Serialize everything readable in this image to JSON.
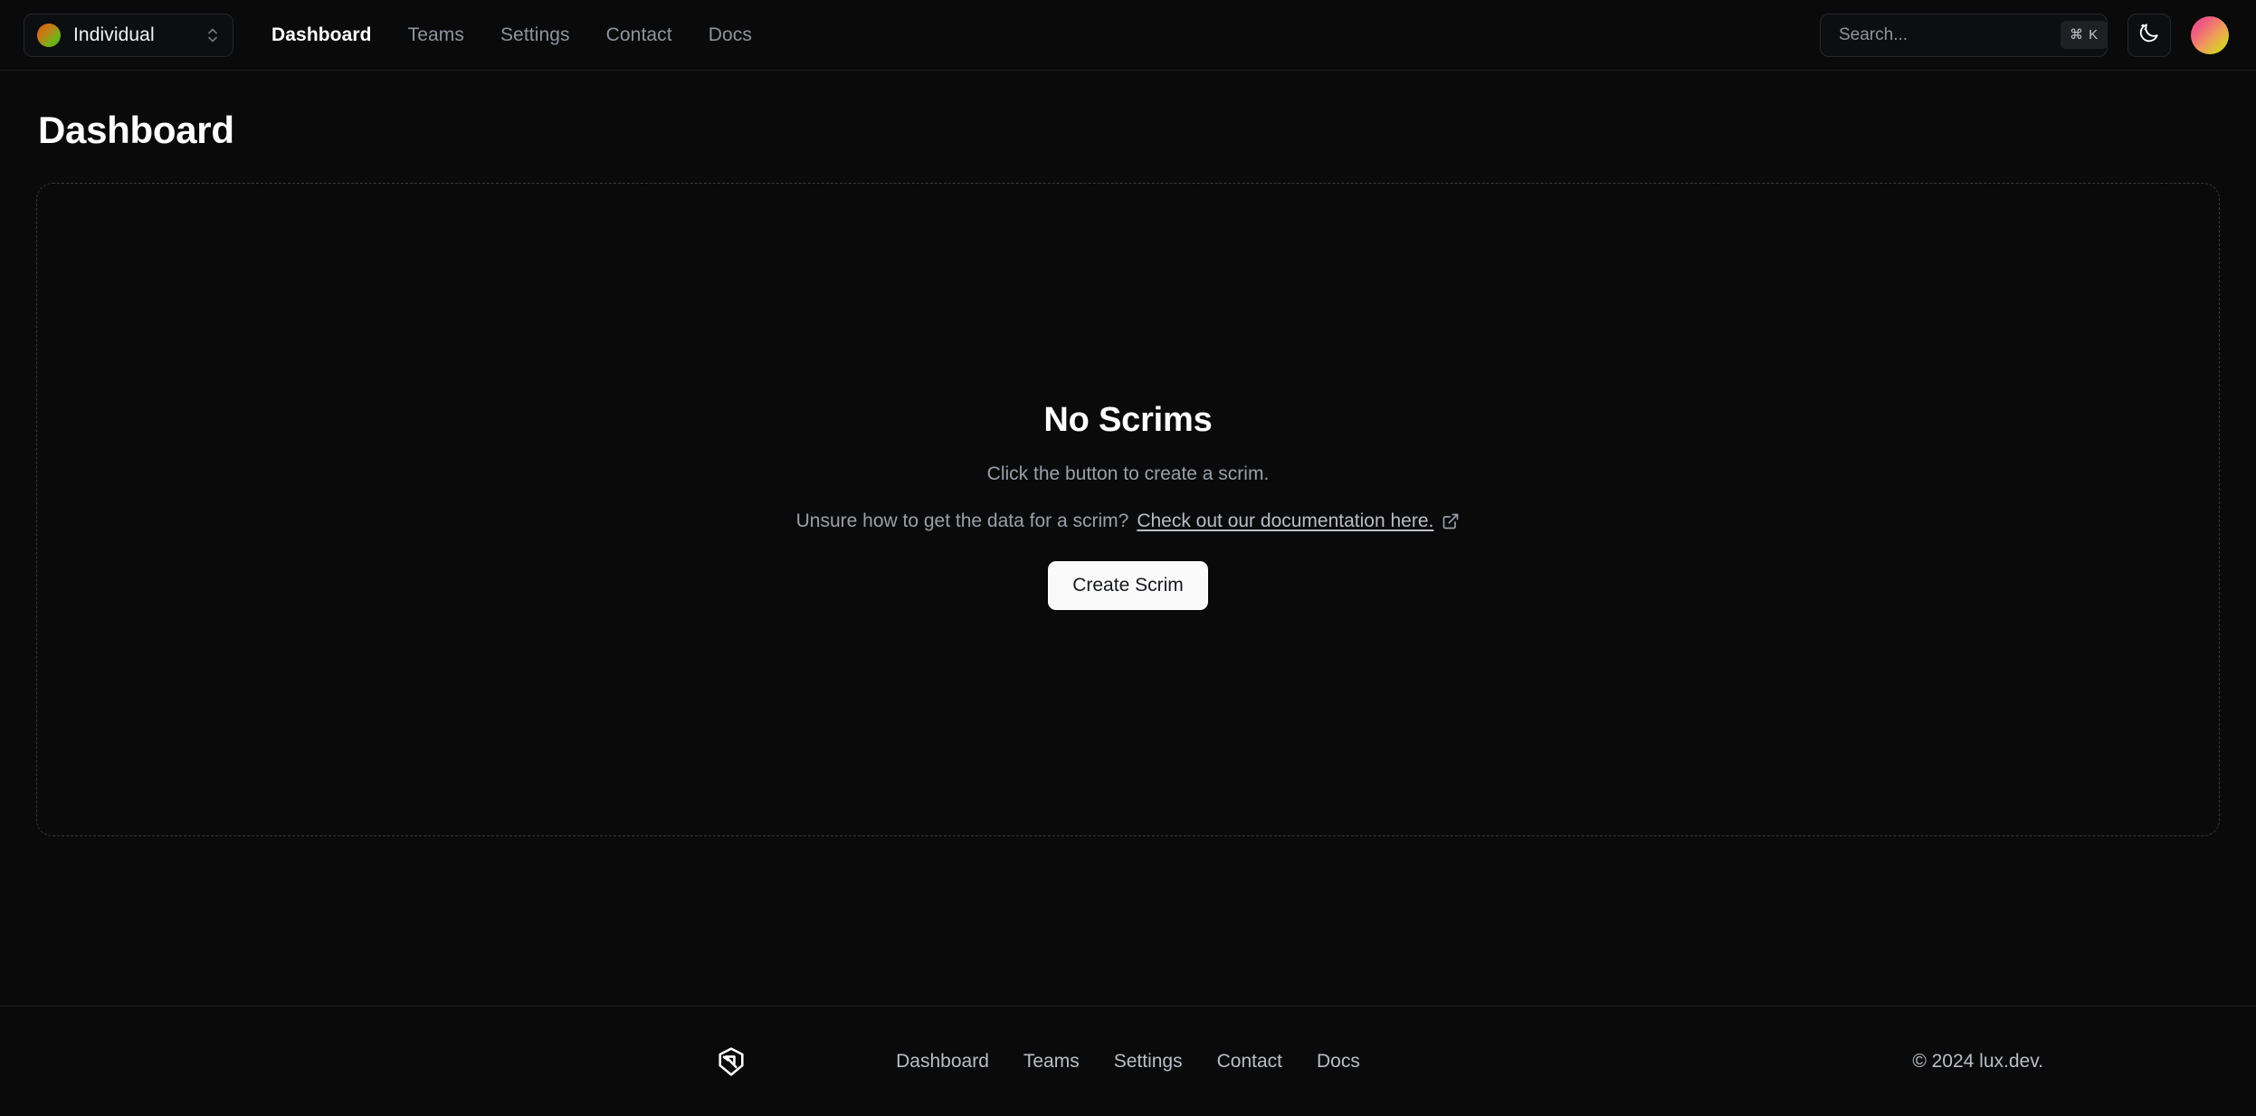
{
  "header": {
    "org_switcher": {
      "name": "Individual",
      "avatar_gradient": [
        "#d1620f",
        "#53a80f"
      ],
      "chevron_icon": "chevron-up-down-icon"
    },
    "nav": [
      {
        "label": "Dashboard",
        "active": true
      },
      {
        "label": "Teams",
        "active": false
      },
      {
        "label": "Settings",
        "active": false
      },
      {
        "label": "Contact",
        "active": false
      },
      {
        "label": "Docs",
        "active": false
      }
    ],
    "search": {
      "placeholder": "Search...",
      "value": "",
      "shortcut": "⌘ K"
    },
    "theme_toggle": {
      "icon": "moon-stars-icon"
    },
    "avatar": {
      "icon": "user-avatar",
      "gradient": [
        "#ee3d8f",
        "#c9d22a"
      ]
    }
  },
  "page": {
    "title": "Dashboard",
    "empty_state": {
      "title": "No Scrims",
      "subtitle": "Click the button to create a scrim.",
      "help_prefix": "Unsure how to get the data for a scrim?",
      "help_link": "Check out our documentation here.",
      "help_link_icon": "external-link-icon",
      "button_label": "Create Scrim"
    }
  },
  "footer": {
    "logo": "lux-shield-logo",
    "nav": [
      {
        "label": "Dashboard"
      },
      {
        "label": "Teams"
      },
      {
        "label": "Settings"
      },
      {
        "label": "Contact"
      },
      {
        "label": "Docs"
      }
    ],
    "copyright": "© 2024 lux.dev."
  },
  "colors": {
    "background": "#0a0a0b",
    "border": "#1d1f22",
    "muted_text": "#8e949c",
    "accent_button": "#fafafa"
  }
}
